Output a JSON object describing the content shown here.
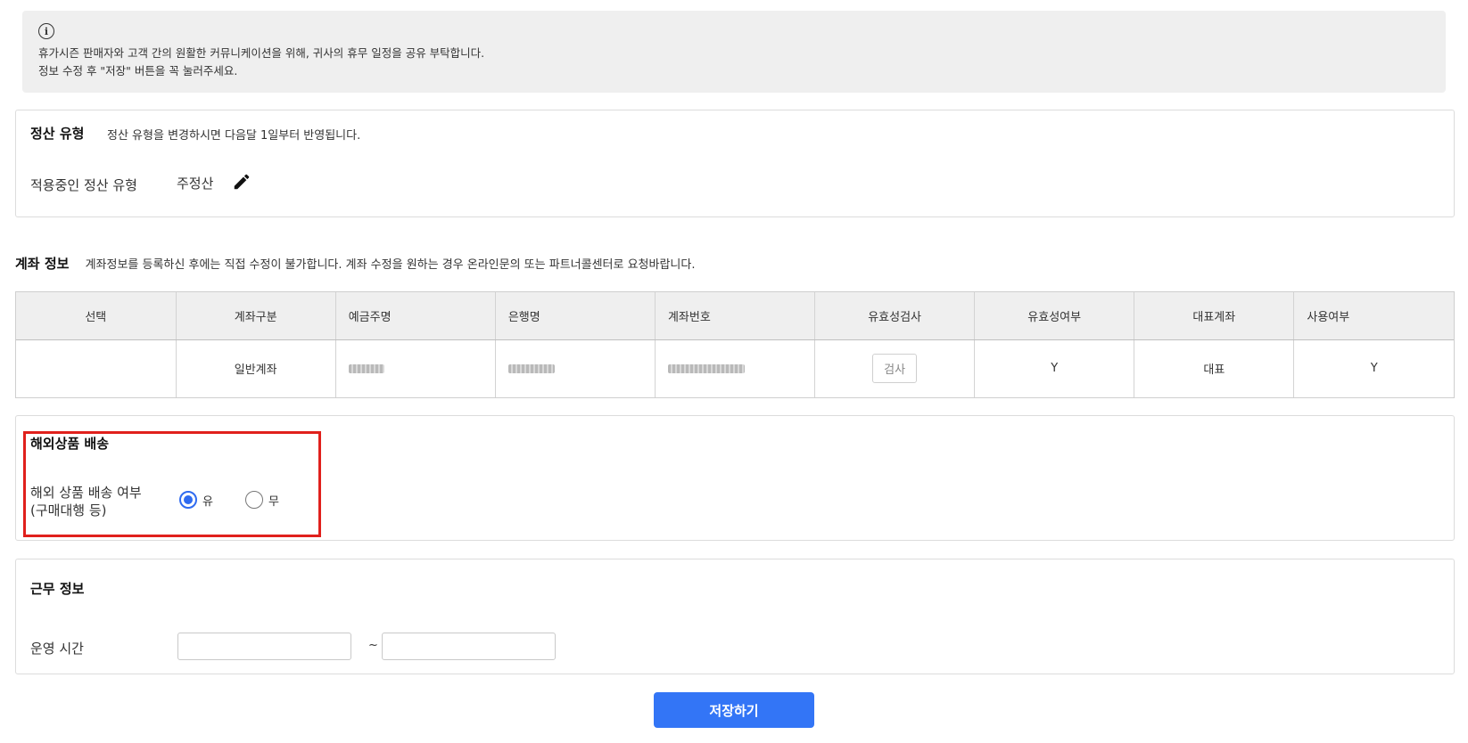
{
  "notice": {
    "line1": "휴가시즌 판매자와 고객 간의 원활한 커뮤니케이션을 위해, 귀사의 휴무 일정을 공유 부탁합니다.",
    "line2": "정보 수정 후 \"저장\" 버튼을 꼭 눌러주세요."
  },
  "settlement": {
    "title": "정산 유형",
    "desc": "정산 유형을 변경하시면 다음달 1일부터 반영됩니다.",
    "field_label": "적용중인 정산 유형",
    "field_value": "주정산"
  },
  "account": {
    "title": "계좌 정보",
    "desc": "계좌정보를 등록하신 후에는 직접 수정이 불가합니다. 계좌 수정을 원하는 경우 온라인문의 또는 파트너콜센터로 요청바랍니다.",
    "columns": [
      "선택",
      "계좌구분",
      "예금주명",
      "은행명",
      "계좌번호",
      "유효성검사",
      "유효성여부",
      "대표계좌",
      "사용여부"
    ],
    "row": {
      "select": "",
      "type": "일반계좌",
      "check_label": "검사",
      "valid": "Y",
      "representative": "대표",
      "use": "Y"
    }
  },
  "overseas": {
    "title": "해외상품 배송",
    "label_line1": "해외 상품 배송 여부",
    "label_line2": "(구매대행 등)",
    "option_yes": "유",
    "option_no": "무",
    "selected": "유"
  },
  "work": {
    "title": "근무 정보",
    "label": "운영 시간",
    "start_value": "",
    "end_value": "",
    "separator": "~"
  },
  "save_label": "저장하기",
  "colors": {
    "accent": "#3375f6",
    "highlight": "#e0201c",
    "notice_bg": "#efefef"
  }
}
